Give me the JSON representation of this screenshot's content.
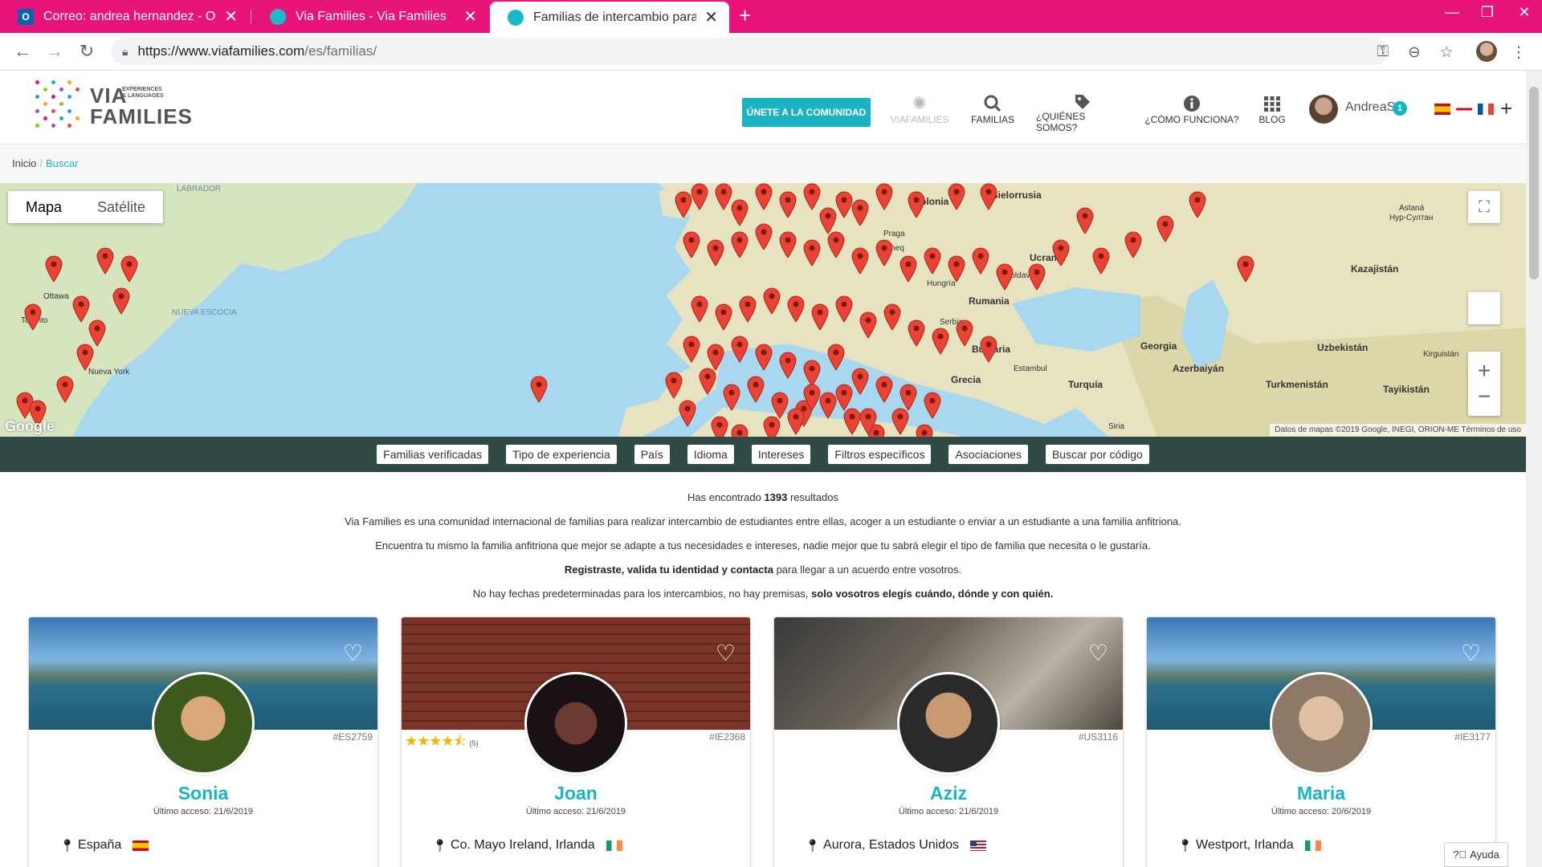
{
  "tabs": [
    {
      "title": "Correo: andrea hernandez - Outl",
      "icon": "outlook-icon"
    },
    {
      "title": "Via Families - Via Families",
      "icon": "viafamilies-icon"
    },
    {
      "title": "Familias de intercambio para estu",
      "icon": "viafamilies-icon",
      "active": true
    }
  ],
  "url": {
    "host": "https://www.viafamilies.com",
    "path": "/es/familias/"
  },
  "logo": {
    "via": "VIA",
    "exp1": "EXPERIENCES",
    "exp2": "& LANGUAGES",
    "families": "FAMILIES"
  },
  "header": {
    "join_label": "ÚNETE A LA COMUNIDAD",
    "nav": [
      {
        "label": "VIAFAMILIES",
        "icon": "gear-icon"
      },
      {
        "label": "FAMILIAS",
        "icon": "search-icon"
      },
      {
        "label": "¿QUIÉNES SOMOS?",
        "icon": "tag-icon"
      },
      {
        "label": "¿CÓMO FUNCIONA?",
        "icon": "info-icon"
      },
      {
        "label": "BLOG",
        "icon": "grid-icon"
      }
    ],
    "user": {
      "name": "AndreaS",
      "badge": "1"
    }
  },
  "breadcrumb": {
    "home": "Inicio",
    "sep": "/",
    "current": "Buscar"
  },
  "map": {
    "type_map": "Mapa",
    "type_sat": "Satélite",
    "google": "Google",
    "attribution": "Datos de mapas ©2019 Google, INEGI, ORION-ME    Términos de uso",
    "labels": {
      "labrador": "LABRADOR",
      "ottawa": "Ottawa",
      "toronto": "Toronto",
      "newyork": "Nueva York",
      "nuevaescocia": "NUEVA ESCOCIA",
      "polonia": "Polonia",
      "bielorrusia": "Bielorrusia",
      "ucrania": "Ucrania",
      "moldavia": "Moldavia",
      "rumania": "Rumania",
      "hungria": "Hungría",
      "praga": "Praga",
      "cheq": "Cheq",
      "serbia": "Serbia",
      "bulgaria": "Bulgaria",
      "estambul": "Estambul",
      "grecia": "Grecia",
      "turquia": "Turquía",
      "georgia": "Georgia",
      "azerbaiyan": "Azerbaiyán",
      "turkmenistan": "Turkmenistán",
      "uzbekistan": "Uzbekistán",
      "kirguistan": "Kirguistán",
      "tayikistan": "Tayikistán",
      "kazajistan": "Kazajistán",
      "astana": "Astaná",
      "nursultan": "Нур-Султан",
      "siria": "Siria"
    }
  },
  "filters": [
    "Familias verificadas",
    "Tipo de experiencia",
    "País",
    "Idioma",
    "Intereses",
    "Filtros específicos",
    "Asociaciones",
    "Buscar por código"
  ],
  "intro": {
    "found_pre": "Has encontrado ",
    "found_count": "1393",
    "found_post": " resultados",
    "p1": "Via Families es una comunidad internacional de familias para realizar intercambio de estudiantes entre ellas, acoger a un estudiante o enviar a un estudiante a una familia anfitriona.",
    "p2": "Encuentra tu mismo la familia anfitriona que mejor se adapte a tus necesidades e intereses, nadie mejor que tu sabrá elegir el tipo de familia que necesita o le gustaría.",
    "p3_bold": "Registraste, valida tu identidad y contacta",
    "p3_rest": " para llegar a un acuerdo entre vosotros.",
    "p4_rest": "No hay fechas predeterminadas para los intercambios, no hay premisas, ",
    "p4_bold": "solo vosotros elegís cuándo, dónde y con quién."
  },
  "cards": [
    {
      "name": "Sonia",
      "code": "#ES2759",
      "access": "Último acceso: 21/6/2019",
      "location": "España",
      "flag": "es"
    },
    {
      "name": "Joan",
      "code": "#IE2368",
      "access": "Último acceso: 21/6/2019",
      "location": "Co. Mayo Ireland, Irlanda",
      "flag": "ie",
      "rating": 4.5,
      "stars": "★★★★⯪",
      "reviews": "(5)"
    },
    {
      "name": "Aziz",
      "code": "#US3116",
      "access": "Último acceso: 21/6/2019",
      "location": "Aurora, Estados Unidos",
      "flag": "us"
    },
    {
      "name": "Maria",
      "code": "#IE3177",
      "access": "Último acceso: 20/6/2019",
      "location": "Westport, Irlanda",
      "flag": "ie"
    }
  ],
  "help_label": "Ayuda"
}
